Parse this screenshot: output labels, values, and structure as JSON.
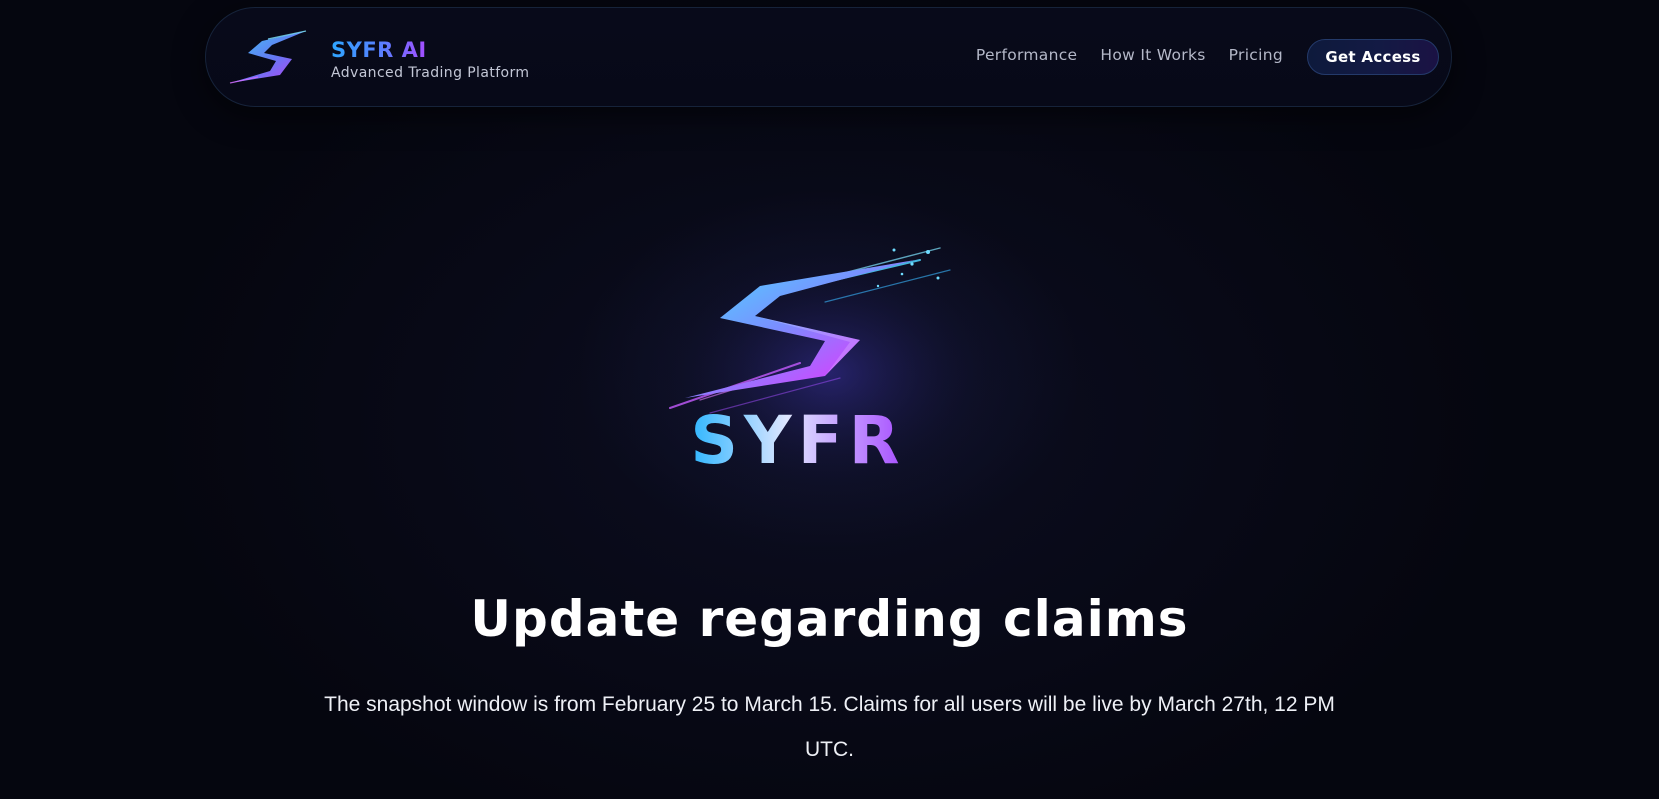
{
  "brand": {
    "name": "SYFR AI",
    "tagline": "Advanced Trading Platform",
    "logo_icon": "syfr-s-logo-icon"
  },
  "nav": {
    "links": [
      {
        "label": "Performance"
      },
      {
        "label": "How It Works"
      },
      {
        "label": "Pricing"
      }
    ],
    "cta_label": "Get Access"
  },
  "hero": {
    "logo_wordmark": "SYFR",
    "title": "Update regarding claims",
    "body": "The snapshot window is from February 25 to March 15. Claims for all users will be live by March 27th, 12 PM UTC."
  },
  "colors": {
    "background": "#05060f",
    "accent_cyan": "#2ea6ff",
    "accent_purple": "#a64dff"
  }
}
